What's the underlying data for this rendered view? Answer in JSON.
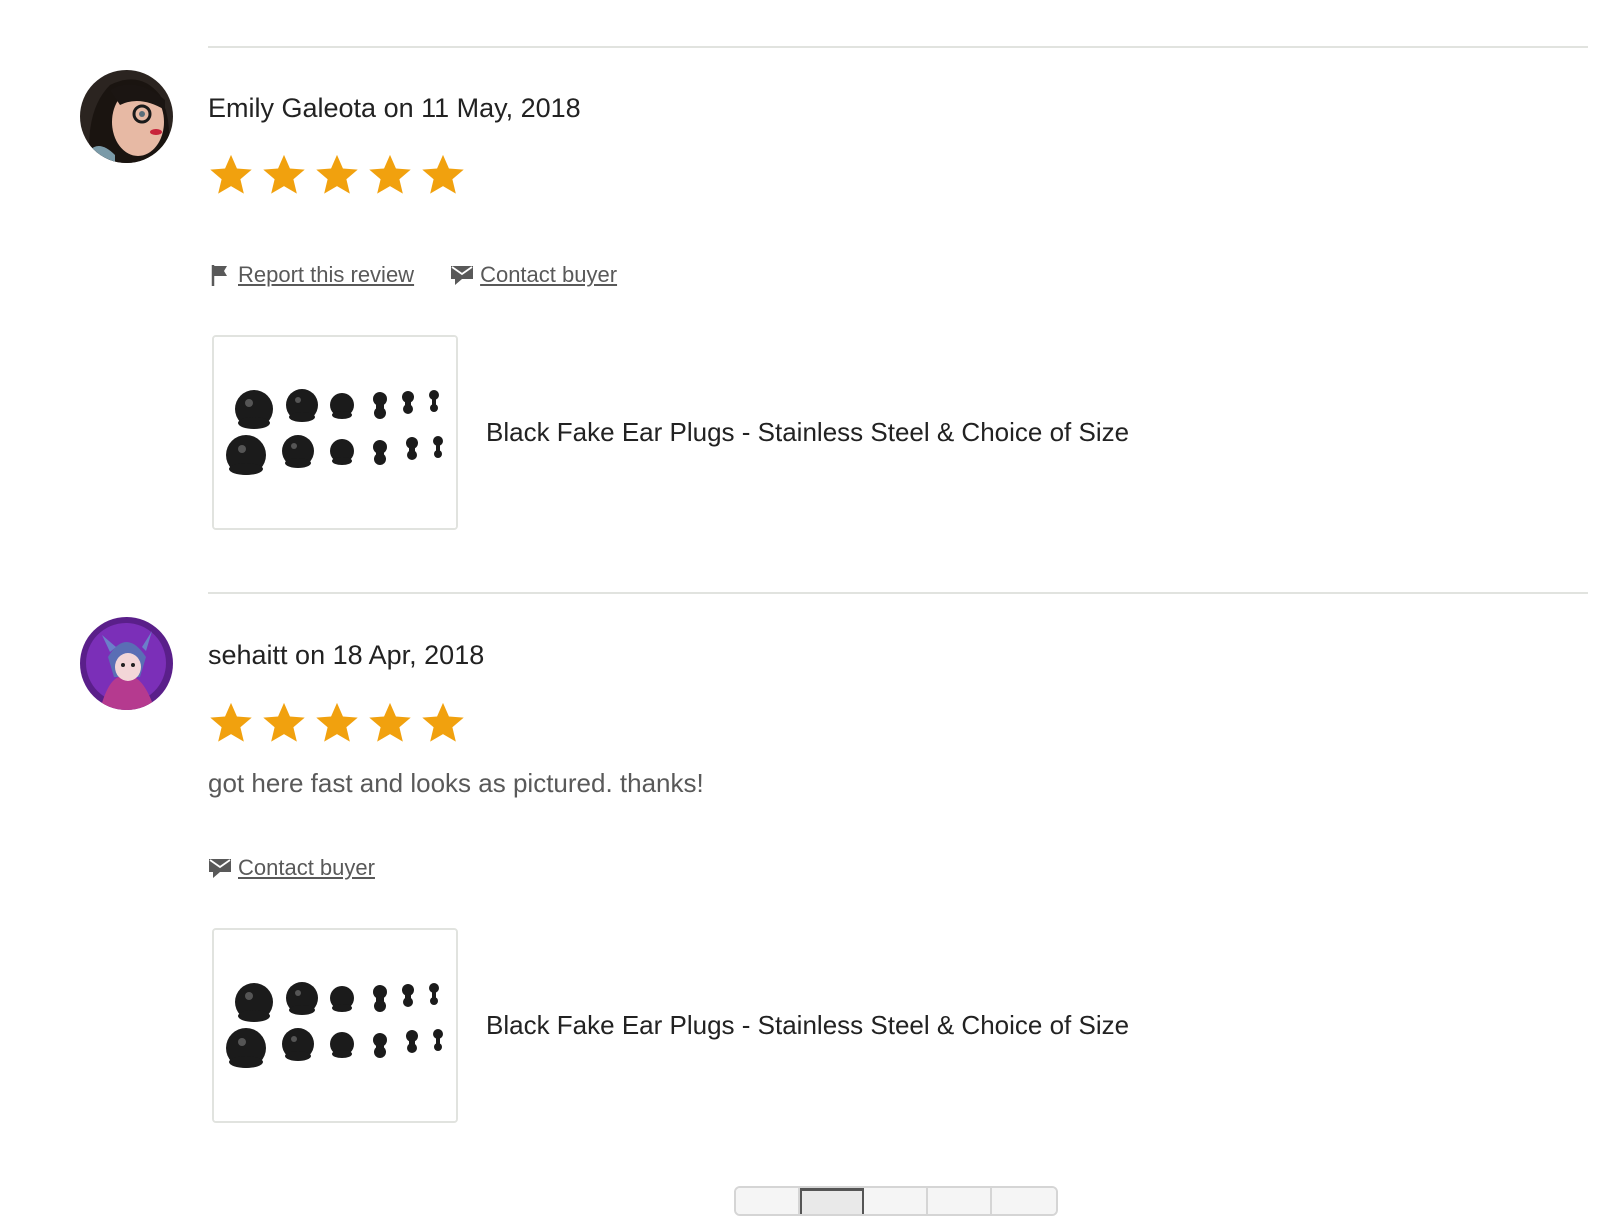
{
  "reviews": [
    {
      "author": "Emily Galeota",
      "date_line": "Emily Galeota on 11 May, 2018",
      "rating": 5,
      "rating_max": 5,
      "text": "",
      "actions": [
        {
          "icon": "flag-icon",
          "label": "Report this review"
        },
        {
          "icon": "message-icon",
          "label": "Contact buyer"
        }
      ],
      "listing": {
        "title": "Black Fake Ear Plugs - Stainless Steel & Choice of Size"
      }
    },
    {
      "author": "sehaitt",
      "date_line": "sehaitt on 18 Apr, 2018",
      "rating": 5,
      "rating_max": 5,
      "text": "got here fast and looks as pictured. thanks!",
      "actions": [
        {
          "icon": "message-icon",
          "label": "Contact buyer"
        }
      ],
      "listing": {
        "title": "Black Fake Ear Plugs - Stainless Steel & Choice of Size"
      }
    }
  ],
  "colors": {
    "star": "#f1a10e",
    "divider": "#e1e3df",
    "muted_text": "#595959"
  }
}
